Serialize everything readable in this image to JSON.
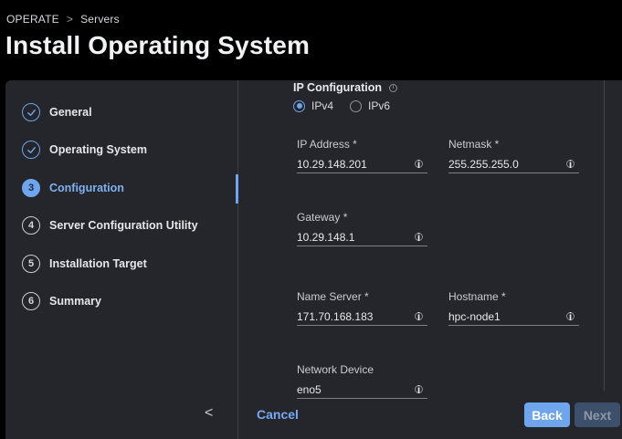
{
  "breadcrumb": {
    "root": "OPERATE",
    "separator": ">",
    "current": "Servers"
  },
  "page_title": "Install Operating System",
  "steps": [
    {
      "marker": "",
      "label": "General",
      "state": "done"
    },
    {
      "marker": "",
      "label": "Operating System",
      "state": "done"
    },
    {
      "marker": "3",
      "label": "Configuration",
      "state": "active"
    },
    {
      "marker": "4",
      "label": "Server Configuration Utility",
      "state": "pending"
    },
    {
      "marker": "5",
      "label": "Installation Target",
      "state": "pending"
    },
    {
      "marker": "6",
      "label": "Summary",
      "state": "pending"
    }
  ],
  "form": {
    "section_title": "IP Configuration",
    "ip_version": {
      "options": [
        "IPv4",
        "IPv6"
      ],
      "selected": "IPv4"
    },
    "fields": {
      "ip_address": {
        "label": "IP Address *",
        "value": "10.29.148.201"
      },
      "netmask": {
        "label": "Netmask *",
        "value": "255.255.255.0"
      },
      "gateway": {
        "label": "Gateway *",
        "value": "10.29.148.1"
      },
      "name_server": {
        "label": "Name Server *",
        "value": "171.70.168.183"
      },
      "hostname": {
        "label": "Hostname *",
        "value": "hpc-node1"
      },
      "network_device": {
        "label": "Network Device",
        "value": "eno5"
      }
    }
  },
  "footer": {
    "collapse_glyph": "<",
    "cancel": "Cancel",
    "back": "Back",
    "next": "Next"
  },
  "colors": {
    "accent": "#6ea5ec",
    "panel": "#24262b",
    "background": "#000000",
    "disabled_button": "#3c4f6b"
  },
  "icons": {
    "done_step": "checkmark-icon",
    "field_info": "info-icon",
    "collapse": "chevron-left-icon"
  }
}
